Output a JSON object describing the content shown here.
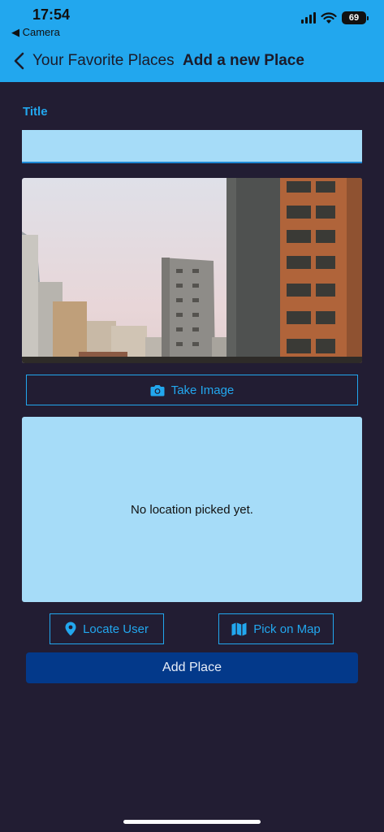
{
  "status_bar": {
    "time": "17:54",
    "back_app": "◀ Camera",
    "battery": "69"
  },
  "nav": {
    "back_label": "Your Favorite Places",
    "title": "Add a new Place"
  },
  "form": {
    "title_label": "Title",
    "title_value": "",
    "take_image_label": "Take Image",
    "take_image_icon": "camera-icon",
    "location_placeholder": "No location picked yet.",
    "locate_user_label": "Locate User",
    "locate_user_icon": "location-pin-icon",
    "pick_map_label": "Pick on Map",
    "pick_map_icon": "map-icon",
    "submit_label": "Add Place"
  },
  "colors": {
    "header": "#22a7ee",
    "background": "#221d33",
    "accent": "#22a7ee",
    "field": "#a6dcf8",
    "primary_button": "#03398a"
  }
}
